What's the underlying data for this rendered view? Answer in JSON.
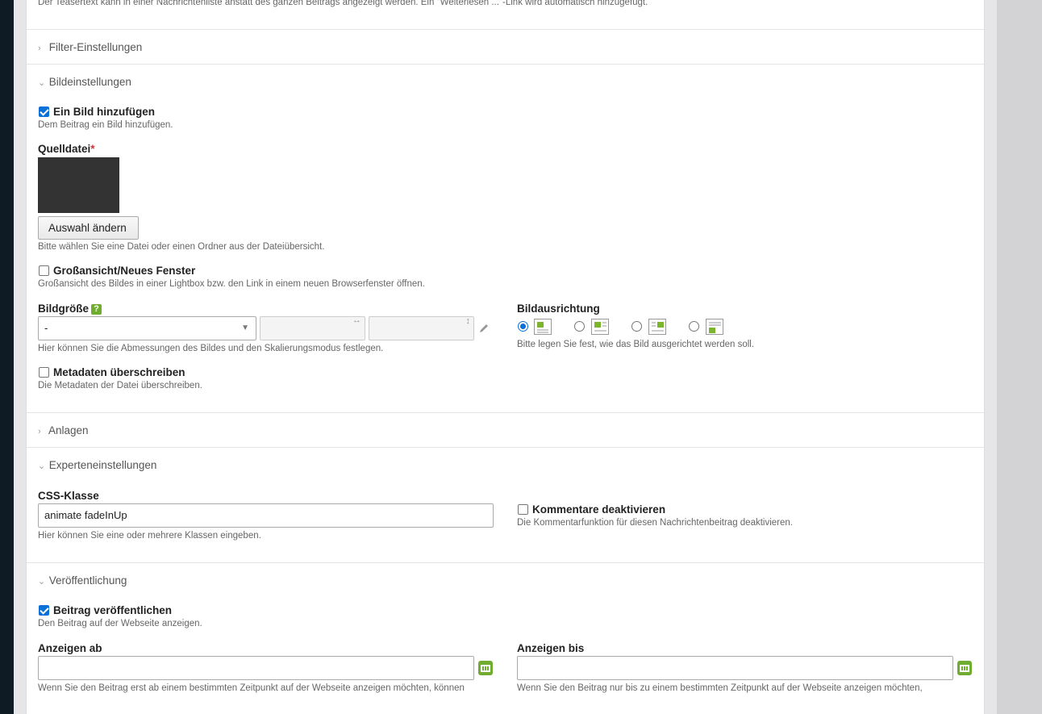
{
  "top_hint": "Der Teasertext kann in einer Nachrichtenliste anstatt des ganzen Beitrags angezeigt werden. Ein \"Weiterlesen ...\"-Link wird automatisch hinzugefügt.",
  "sections": {
    "filter": "Filter-Einstellungen",
    "image": "Bildeinstellungen",
    "attachments": "Anlagen",
    "expert": "Experteneinstellungen",
    "publish": "Veröffentlichung"
  },
  "image": {
    "add_label": "Ein Bild hinzufügen",
    "add_hint": "Dem Beitrag ein Bild hinzufügen.",
    "source_label": "Quelldatei",
    "required_mark": "*",
    "change_button": "Auswahl ändern",
    "source_hint": "Bitte wählen Sie eine Datei oder einen Ordner aus der Dateiübersicht.",
    "fullsize_label": "Großansicht/Neues Fenster",
    "fullsize_hint": "Großansicht des Bildes in einer Lightbox bzw. den Link in einem neuen Browserfenster öffnen.",
    "size_label": "Bildgröße",
    "help_glyph": "?",
    "size_select_value": "-",
    "width_glyph": "↔",
    "height_glyph": "↕",
    "size_hint": "Hier können Sie die Abmessungen des Bildes und den Skalierungsmodus festlegen.",
    "alignment_label": "Bildausrichtung",
    "alignment_hint": "Bitte legen Sie fest, wie das Bild ausgerichtet werden soll.",
    "metadata_label": "Metadaten überschreiben",
    "metadata_hint": "Die Metadaten der Datei überschreiben.",
    "add_checked": true,
    "fullsize_checked": false,
    "metadata_checked": false,
    "alignment_selected": 0
  },
  "expert": {
    "css_label": "CSS-Klasse",
    "css_value": "animate fadeInUp",
    "css_hint": "Hier können Sie eine oder mehrere Klassen eingeben.",
    "comments_label": "Kommentare deaktivieren",
    "comments_hint": "Die Kommentarfunktion für diesen Nachrichtenbeitrag deaktivieren.",
    "comments_checked": false
  },
  "publish": {
    "publish_label": "Beitrag veröffentlichen",
    "publish_hint": "Den Beitrag auf der Webseite anzeigen.",
    "publish_checked": true,
    "start_label": "Anzeigen ab",
    "start_value": "",
    "start_hint": "Wenn Sie den Beitrag erst ab einem bestimmten Zeitpunkt auf der Webseite anzeigen möchten, können",
    "stop_label": "Anzeigen bis",
    "stop_value": "",
    "stop_hint": "Wenn Sie den Beitrag nur bis zu einem bestimmten Zeitpunkt auf der Webseite anzeigen möchten,"
  },
  "icons": {
    "collapsed": "chevron-right-icon",
    "expanded": "chevron-down-icon",
    "calendar": "calendar-icon",
    "edit": "pencil-icon",
    "help": "help-icon"
  },
  "colors": {
    "accent_blue": "#0a6fd6",
    "icon_green": "#6fac2f",
    "sidebar_dark": "#0f1b24"
  }
}
